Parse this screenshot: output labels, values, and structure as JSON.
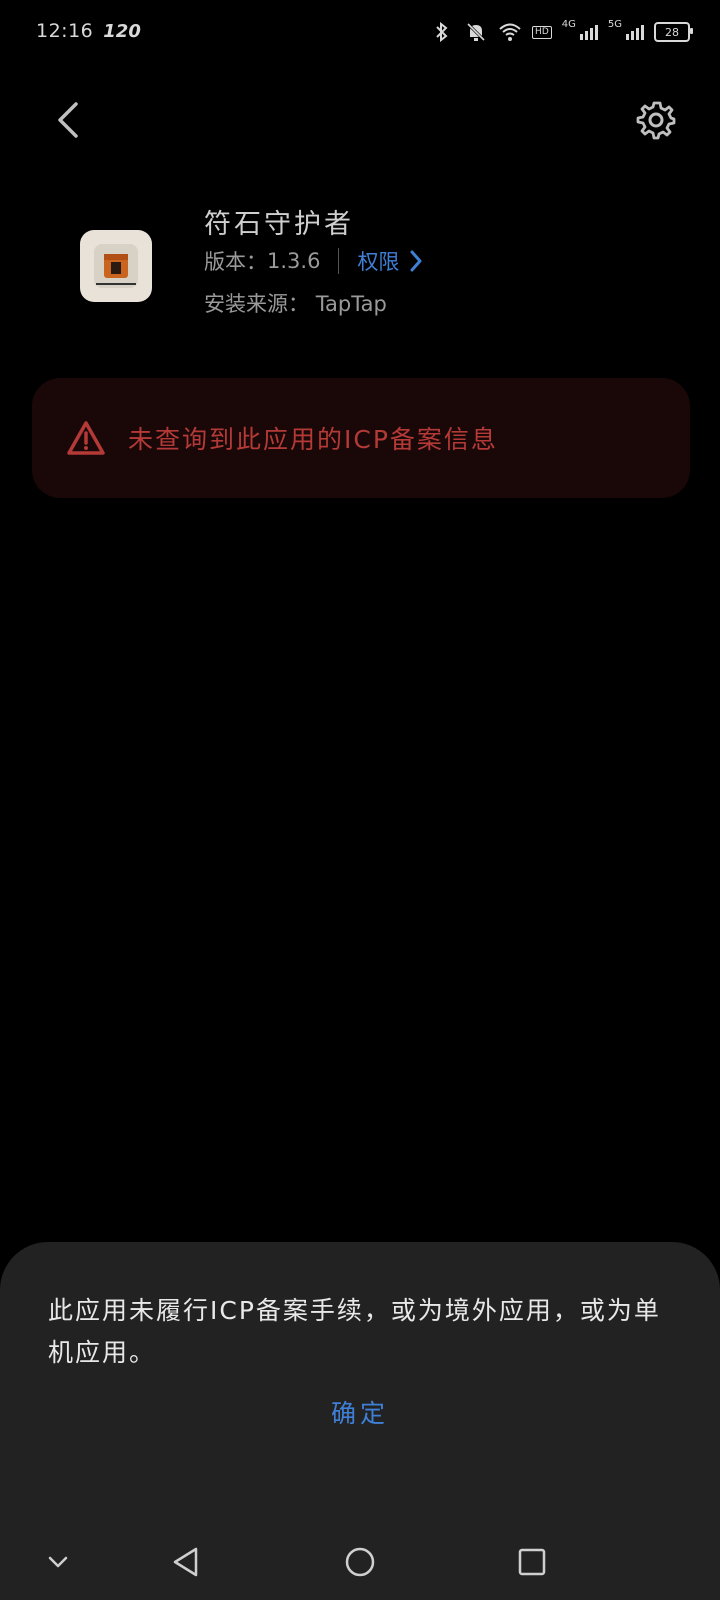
{
  "status_bar": {
    "time": "12:16",
    "refresh_rate": "120",
    "hd_label": "HD",
    "net1": "4G",
    "net2": "5G",
    "battery": "28"
  },
  "app": {
    "name": "符石守护者",
    "version_label": "版本：",
    "version_value": "1.3.6",
    "permissions_label": "权限",
    "source_label": "安装来源：",
    "source_value": "TapTap"
  },
  "warning": {
    "text": "未查询到此应用的ICP备案信息",
    "color": "#b33a36"
  },
  "sheet": {
    "message": "此应用未履行ICP备案手续，或为境外应用，或为单机应用。",
    "confirm_label": "确定"
  },
  "colors": {
    "accent": "#3f7fd6",
    "background": "#000000",
    "sheet": "#222222"
  },
  "icons": {
    "back": "chevron-left-icon",
    "settings": "gear-icon",
    "warning": "warning-triangle-icon"
  }
}
